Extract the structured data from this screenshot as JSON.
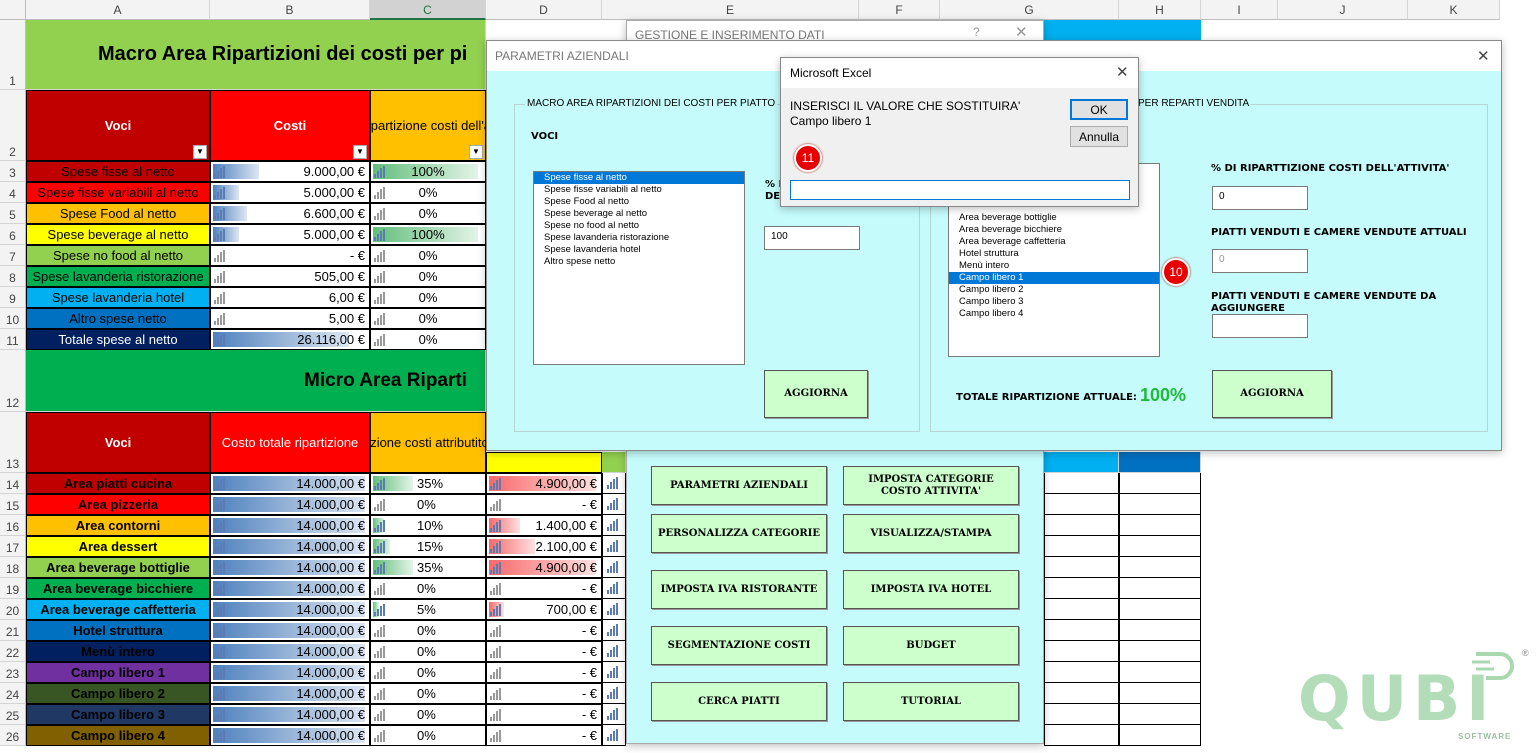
{
  "columns": [
    "A",
    "B",
    "C",
    "D",
    "E",
    "F",
    "G",
    "H",
    "I",
    "J",
    "K"
  ],
  "rows": [
    "1",
    "2",
    "3",
    "4",
    "5",
    "6",
    "7",
    "8",
    "9",
    "10",
    "11",
    "12",
    "13",
    "14",
    "15",
    "16",
    "17",
    "18",
    "19",
    "20",
    "21",
    "22",
    "23",
    "24",
    "25",
    "26"
  ],
  "sheet": {
    "macro_title": "Macro Area Ripartizioni dei costi per pi",
    "micro_title": "Micro Area Riparti",
    "hdr_voci": "Voci",
    "hdr_costi": "Costi",
    "hdr_pct_attivita": "% di ripartizione costi dell'attività",
    "hdr_costo_tot": "Costo totale ripartizione",
    "hdr_pct_reparto": "% di ripartizione costi attributito al reparto",
    "macro_rows": [
      {
        "label": "Spese fisse al netto",
        "cost": "9.000,00 €",
        "pct": "100%",
        "bar": 0.34,
        "pbar": 1.0,
        "bg": "#c00000",
        "fg": "#000"
      },
      {
        "label": "Spese fisse variabili al netto",
        "cost": "5.000,00 €",
        "pct": "0%",
        "bar": 0.19,
        "pbar": 0,
        "bg": "#ff0000",
        "fg": "#000"
      },
      {
        "label": "Spese Food al netto",
        "cost": "6.600,00 €",
        "pct": "0%",
        "bar": 0.25,
        "pbar": 0,
        "bg": "#ffc000",
        "fg": "#000"
      },
      {
        "label": "Spese beverage al netto",
        "cost": "5.000,00 €",
        "pct": "100%",
        "bar": 0.19,
        "pbar": 1.0,
        "bg": "#ffff00",
        "fg": "#000"
      },
      {
        "label": "Spese no food al netto",
        "cost": "-     €",
        "pct": "0%",
        "bar": 0,
        "pbar": 0,
        "bg": "#92d050",
        "fg": "#000"
      },
      {
        "label": "Spese lavanderia ristorazione",
        "cost": "505,00 €",
        "pct": "0%",
        "bar": 0,
        "pbar": 0,
        "bg": "#00b050",
        "fg": "#000"
      },
      {
        "label": "Spese lavanderia hotel",
        "cost": "6,00 €",
        "pct": "0%",
        "bar": 0,
        "pbar": 0,
        "bg": "#00b0f0",
        "fg": "#000"
      },
      {
        "label": "Altro spese netto",
        "cost": "5,00 €",
        "pct": "0%",
        "bar": 0,
        "pbar": 0,
        "bg": "#0070c0",
        "fg": "#000"
      },
      {
        "label": "Totale spese al netto",
        "cost": "26.116,00 €",
        "pct": "0%",
        "bar": 1.0,
        "pbar": 0,
        "bg": "#002060",
        "fg": "#fff"
      }
    ],
    "micro_rows": [
      {
        "label": "Area piatti cucina",
        "cost": "14.000,00 €",
        "pct": "35%",
        "dval": "4.900,00 €",
        "pbar": 0.35,
        "dbar": 1.0,
        "bg": "#c00000",
        "fg": "#000"
      },
      {
        "label": "Area pizzeria",
        "cost": "14.000,00 €",
        "pct": "0%",
        "dval": "-     €",
        "pbar": 0,
        "dbar": 0,
        "bg": "#ff0000",
        "fg": "#000"
      },
      {
        "label": "Area contorni",
        "cost": "14.000,00 €",
        "pct": "10%",
        "dval": "1.400,00 €",
        "pbar": 0.1,
        "dbar": 0.29,
        "bg": "#ffc000",
        "fg": "#000"
      },
      {
        "label": "Area dessert",
        "cost": "14.000,00 €",
        "pct": "15%",
        "dval": "2.100,00 €",
        "pbar": 0.15,
        "dbar": 0.43,
        "bg": "#ffff00",
        "fg": "#000"
      },
      {
        "label": "Area beverage bottiglie",
        "cost": "14.000,00 €",
        "pct": "35%",
        "dval": "4.900,00 €",
        "pbar": 0.35,
        "dbar": 1.0,
        "bg": "#92d050",
        "fg": "#000"
      },
      {
        "label": "Area beverage bicchiere",
        "cost": "14.000,00 €",
        "pct": "0%",
        "dval": "-     €",
        "pbar": 0,
        "dbar": 0,
        "bg": "#00b050",
        "fg": "#000"
      },
      {
        "label": "Area beverage caffetteria",
        "cost": "14.000,00 €",
        "pct": "5%",
        "dval": "700,00 €",
        "pbar": 0.05,
        "dbar": 0.14,
        "bg": "#00b0f0",
        "fg": "#000"
      },
      {
        "label": "Hotel struttura",
        "cost": "14.000,00 €",
        "pct": "0%",
        "dval": "-     €",
        "pbar": 0,
        "dbar": 0,
        "bg": "#0070c0",
        "fg": "#000"
      },
      {
        "label": "Menù intero",
        "cost": "14.000,00 €",
        "pct": "0%",
        "dval": "-     €",
        "pbar": 0,
        "dbar": 0,
        "bg": "#002060",
        "fg": "#000"
      },
      {
        "label": "Campo libero 1",
        "cost": "14.000,00 €",
        "pct": "0%",
        "dval": "-     €",
        "pbar": 0,
        "dbar": 0,
        "bg": "#7030a0",
        "fg": "#000"
      },
      {
        "label": "Campo libero 2",
        "cost": "14.000,00 €",
        "pct": "0%",
        "dval": "-     €",
        "pbar": 0,
        "dbar": 0,
        "bg": "#375623",
        "fg": "#000"
      },
      {
        "label": "Campo libero 3",
        "cost": "14.000,00 €",
        "pct": "0%",
        "dval": "-     €",
        "pbar": 0,
        "dbar": 0,
        "bg": "#203864",
        "fg": "#000"
      },
      {
        "label": "Campo libero 4",
        "cost": "14.000,00 €",
        "pct": "0%",
        "dval": "-     €",
        "pbar": 0,
        "dbar": 0,
        "bg": "#806000",
        "fg": "#000"
      }
    ]
  },
  "gestione": {
    "title": "GESTIONE E INSERIMENTO DATI",
    "help": "?",
    "buttons": [
      "PARAMETRI AZIENDALI",
      "IMPOSTA CATEGORIE COSTO ATTIVITA'",
      "PERSONALIZZA CATEGORIE",
      "VISUALIZZA/STAMPA",
      "IMPOSTA IVA RISTORANTE",
      "IMPOSTA IVA HOTEL",
      "SEGMENTAZIONE COSTI",
      "BUDGET",
      "CERCA PIATTI",
      "TUTORIAL"
    ]
  },
  "parametri": {
    "title": "PARAMETRI AZIENDALI",
    "left_frame": "MACRO AREA RIPARTIZIONI DEI COSTI PER PIATTO",
    "voci_label": "VOCI",
    "voci_items": [
      "Spese fisse al netto",
      "Spese fisse variabili al netto",
      "Spese Food al netto",
      "Spese beverage al netto",
      "Spese no food al netto",
      "Spese lavanderia ristorazione",
      "Spese lavanderia hotel",
      "Altro spese netto"
    ],
    "pct_label_short": "% I",
    "pct_label_short2": "DEI",
    "pct_value": "100",
    "aggiorna": "AGGIORNA",
    "right_frame": "PER REPARTI VENDITA",
    "reparti_items": [
      "Area beverage bottiglie",
      "Area beverage bicchiere",
      "Area beverage caffetteria",
      "Hotel struttura",
      "Menù intero",
      "Campo libero 1",
      "Campo libero 2",
      "Campo libero 3",
      "Campo libero 4"
    ],
    "reparti_selected": "Campo libero 1",
    "lbl_pct": "% DI RIPARTTIZIONE COSTI DELL'ATTIVITA'",
    "val_pct": "0",
    "lbl_attuali": "PIATTI VENDUTI E CAMERE VENDUTE ATTUALI",
    "val_attuali": "0",
    "lbl_aggiungere": "PIATTI VENDUTI E CAMERE VENDUTE DA AGGIUNGERE",
    "val_aggiungere": "",
    "totale_label": "TOTALE RIPARTIZIONE ATTUALE:",
    "totale_value": "100%"
  },
  "inputbox": {
    "title": "Microsoft Excel",
    "prompt": "INSERISCI IL VALORE CHE SOSTITUIRA' Campo libero 1",
    "ok": "OK",
    "cancel": "Annulla",
    "value": ""
  },
  "badges": {
    "b10": "10",
    "b11": "11"
  },
  "logo": {
    "text": "QUBI",
    "sub": "SOFTWARE",
    "reg": "®"
  }
}
